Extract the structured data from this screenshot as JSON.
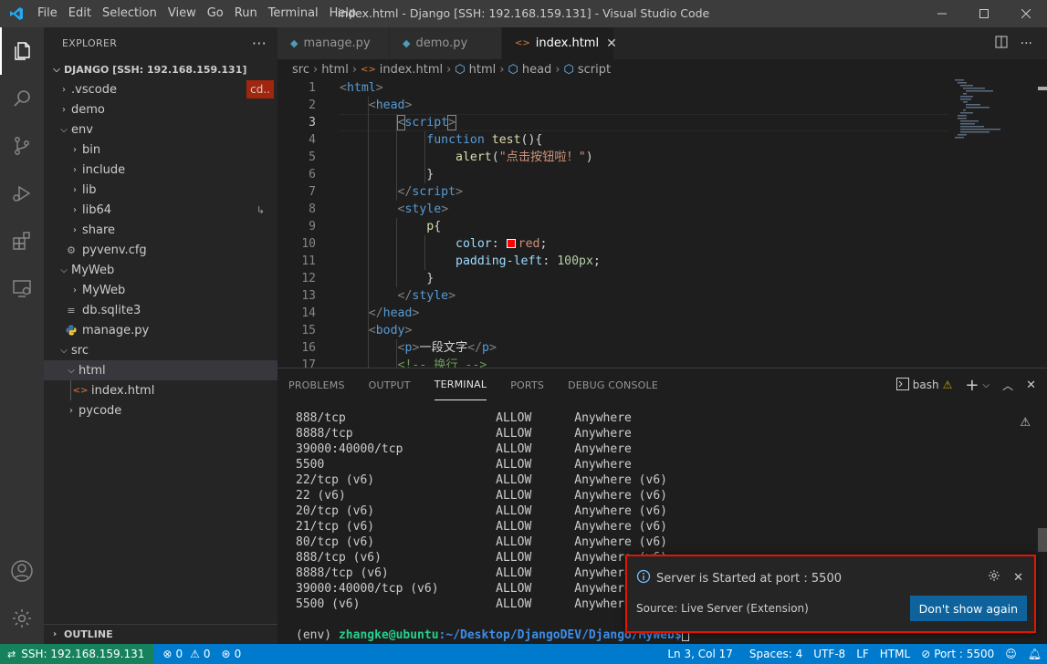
{
  "window": {
    "title": "index.html - Django [SSH: 192.168.159.131] - Visual Studio Code",
    "menus": [
      "File",
      "Edit",
      "Selection",
      "View",
      "Go",
      "Run",
      "Terminal",
      "Help"
    ]
  },
  "sidebar": {
    "header": "EXPLORER",
    "root": "DJANGO [SSH: 192.168.159.131]",
    "vscode_badge": "cd..",
    "items": [
      {
        "label": ".vscode"
      },
      {
        "label": "demo"
      },
      {
        "label": "env"
      },
      {
        "label": "bin"
      },
      {
        "label": "include"
      },
      {
        "label": "lib"
      },
      {
        "label": "lib64"
      },
      {
        "label": "share"
      },
      {
        "label": "pyvenv.cfg"
      },
      {
        "label": "MyWeb"
      },
      {
        "label": "MyWeb"
      },
      {
        "label": "db.sqlite3"
      },
      {
        "label": "manage.py"
      },
      {
        "label": "src"
      },
      {
        "label": "html"
      },
      {
        "label": "index.html"
      },
      {
        "label": "pycode"
      }
    ],
    "outline": "OUTLINE"
  },
  "tabs": [
    {
      "label": "manage.py",
      "icon": "python-icon"
    },
    {
      "label": "demo.py",
      "icon": "python-icon"
    },
    {
      "label": "index.html",
      "icon": "html-icon",
      "active": true
    }
  ],
  "breadcrumb": [
    "src",
    "html",
    "index.html",
    "html",
    "head",
    "script"
  ],
  "editor": {
    "line_numbers": [
      "1",
      "2",
      "3",
      "4",
      "5",
      "6",
      "7",
      "8",
      "9",
      "10",
      "11",
      "12",
      "13",
      "14",
      "15",
      "16",
      "17"
    ],
    "alert_text": "\"点击按钮啦！\"",
    "p_text": "一段文字",
    "comment_text": "<!-- 换行 -->"
  },
  "panel": {
    "tabs": [
      "PROBLEMS",
      "OUTPUT",
      "TERMINAL",
      "PORTS",
      "DEBUG CONSOLE"
    ],
    "active_tab": "TERMINAL",
    "shell": "bash",
    "terminal_rows": [
      [
        "888/tcp",
        "ALLOW",
        "Anywhere"
      ],
      [
        "8888/tcp",
        "ALLOW",
        "Anywhere"
      ],
      [
        "39000:40000/tcp",
        "ALLOW",
        "Anywhere"
      ],
      [
        "5500",
        "ALLOW",
        "Anywhere"
      ],
      [
        "22/tcp (v6)",
        "ALLOW",
        "Anywhere (v6)"
      ],
      [
        "22 (v6)",
        "ALLOW",
        "Anywhere (v6)"
      ],
      [
        "20/tcp (v6)",
        "ALLOW",
        "Anywhere (v6)"
      ],
      [
        "21/tcp (v6)",
        "ALLOW",
        "Anywhere (v6)"
      ],
      [
        "80/tcp (v6)",
        "ALLOW",
        "Anywhere (v6)"
      ],
      [
        "888/tcp (v6)",
        "ALLOW",
        "Anywhere (v6)"
      ],
      [
        "8888/tcp (v6)",
        "ALLOW",
        "Anywhere (v6)"
      ],
      [
        "39000:40000/tcp (v6)",
        "ALLOW",
        "Anywhere (v6)"
      ],
      [
        "5500 (v6)",
        "ALLOW",
        "Anywhere (v6)"
      ]
    ],
    "prompt_env": "(env) ",
    "prompt_user": "zhangke@ubuntu",
    "prompt_path": ":~/Desktop/DjangoDEV/Django/MyWeb$"
  },
  "notification": {
    "message": "Server is Started at port : 5500",
    "source": "Source: Live Server (Extension)",
    "button": "Don't show again"
  },
  "statusbar": {
    "remote": "SSH: 192.168.159.131",
    "errors": "0",
    "warnings": "0",
    "ports": "0",
    "position": "Ln 3, Col 17",
    "spaces": "Spaces: 4",
    "encoding": "UTF-8",
    "eol": "LF",
    "language": "HTML",
    "port": "Port : 5500"
  },
  "colors": {
    "accent": "#007acc",
    "remote": "#16825d",
    "highlight_border": "#e51400"
  }
}
